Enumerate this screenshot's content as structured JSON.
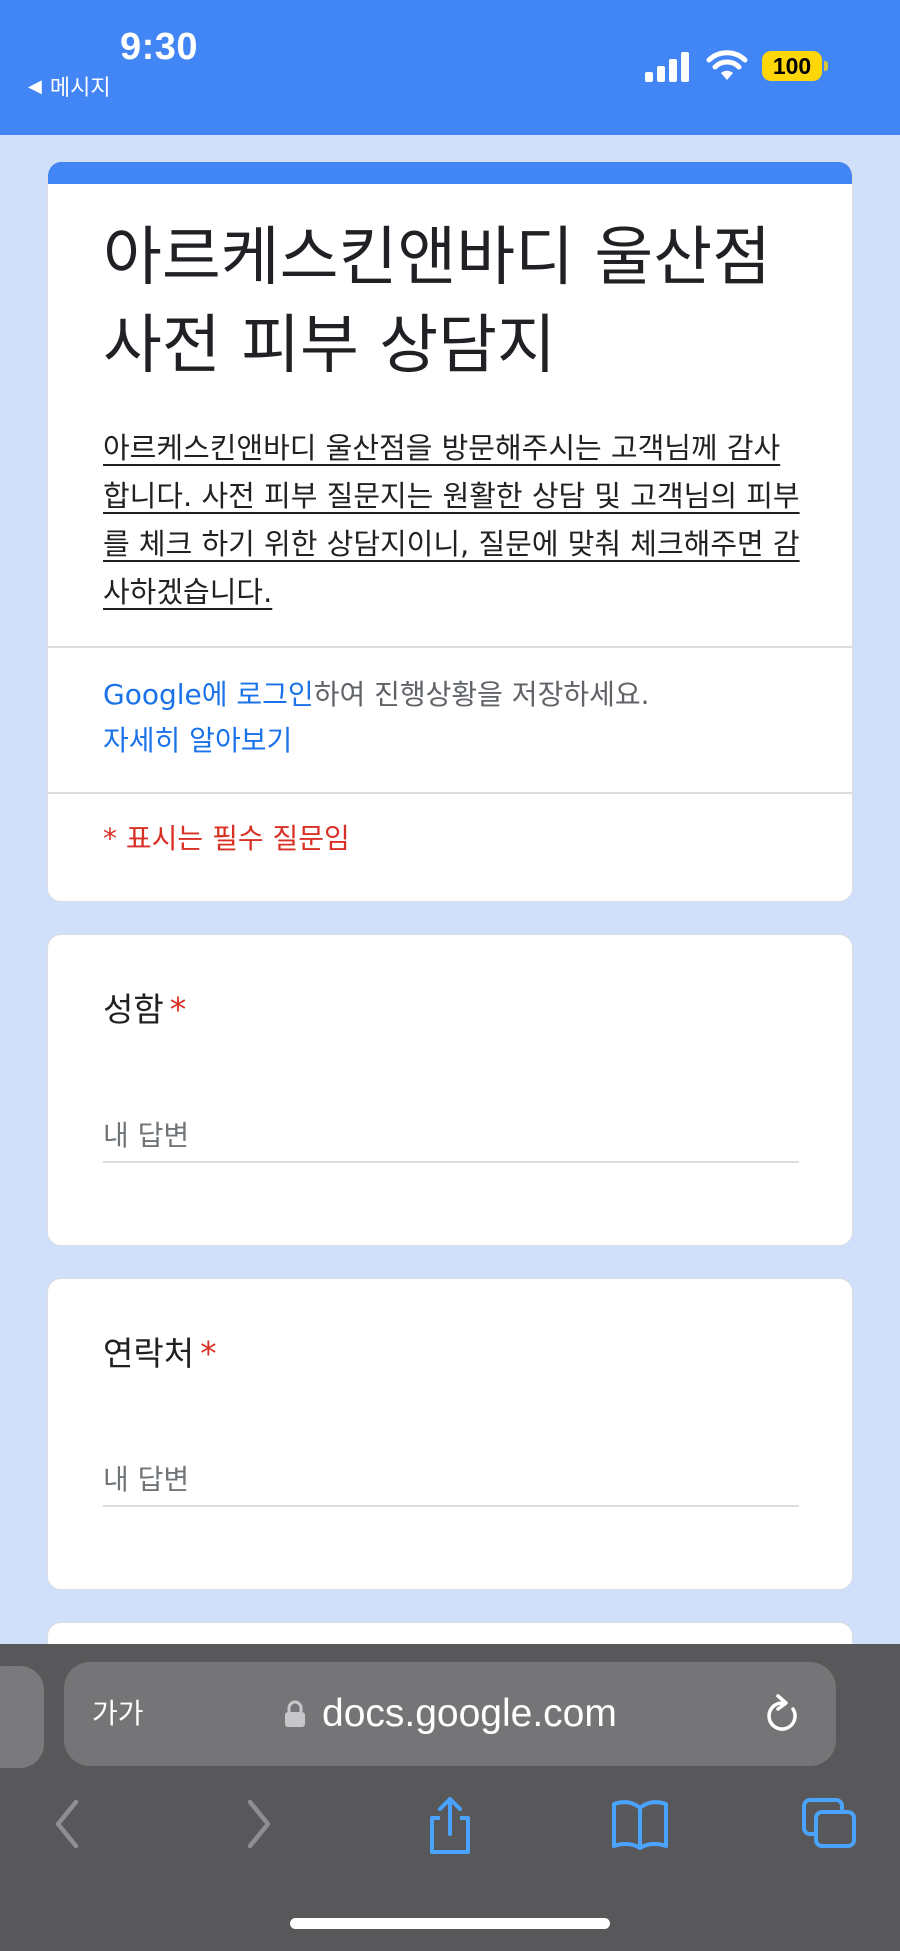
{
  "status_bar": {
    "time": "9:30",
    "back_label": "메시지",
    "battery": "100",
    "background_color": "#4285f4",
    "battery_color": "#ffd60a"
  },
  "form": {
    "title": "아르케스킨앤바디 울산점 사전 피부 상담지",
    "description": "아르케스킨앤바디 울산점을 방문해주시는 고객님께 감사합니다. 사전 피부 질문지는 원활한 상담 및 고객님의 피부를 체크 하기 위한 상담지이니, 질문에 맞춰 체크해주면 감사하겠습니다.",
    "login_link": "Google에 로그인",
    "login_suffix": "하여 진행상황을 저장하세요.",
    "learn_more": "자세히 알아보기",
    "required_note": "* 표시는 필수 질문임",
    "accent_color": "#4285f4",
    "page_background": "#d1e0fa",
    "required_color": "#d93025",
    "link_color": "#1a73e8"
  },
  "questions": [
    {
      "label": "성함",
      "required_marker": "*",
      "placeholder": "내 답변",
      "value": ""
    },
    {
      "label": "연락처",
      "required_marker": "*",
      "placeholder": "내 답변",
      "value": ""
    }
  ],
  "safari": {
    "text_size_button": "가가",
    "url": "docs.google.com",
    "icons": [
      "lock-icon",
      "reload-icon",
      "back-arrow-icon",
      "forward-arrow-icon",
      "share-icon",
      "bookmarks-icon",
      "tabs-icon"
    ]
  }
}
